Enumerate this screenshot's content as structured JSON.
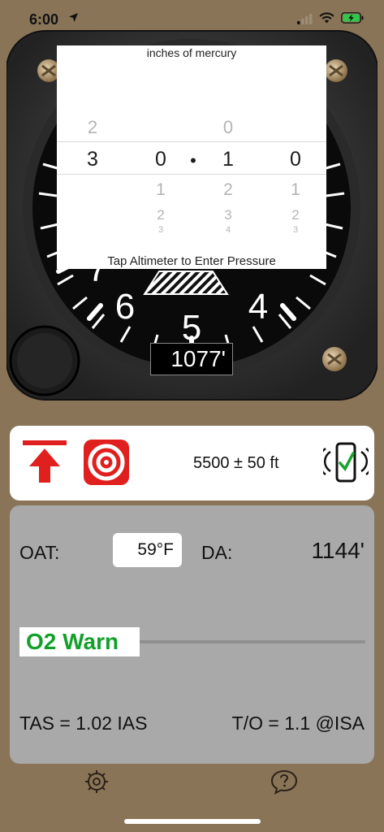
{
  "status_bar": {
    "time": "6:00"
  },
  "picker": {
    "title": "inches of mercury",
    "columns": [
      {
        "above": "",
        "selected": "3",
        "below": []
      },
      {
        "above": "",
        "selected": "0",
        "below": [
          "1",
          "2",
          "3"
        ]
      },
      {
        "above": "",
        "selected": "•",
        "below": []
      },
      {
        "above": "0",
        "selected": "1",
        "below": [
          "2",
          "3",
          "4"
        ]
      },
      {
        "above": "",
        "selected": "0",
        "below": [
          "1",
          "2",
          "3"
        ]
      }
    ],
    "above_first": "2",
    "footer": "Tap Altimeter to Enter Pressure"
  },
  "altimeter": {
    "readout": "1077'",
    "dial_numbers": [
      "4",
      "5",
      "6",
      "7"
    ]
  },
  "pressure_card": {
    "altitude_text": "5500 ± 50 ft",
    "icons": [
      "altitude-mark-icon",
      "target-icon",
      "phone-connected-icon"
    ]
  },
  "info_card": {
    "oat_label": "OAT:",
    "oat_value": "59°F",
    "da_label": "DA:",
    "da_value": "1144'",
    "o2_warn": "O2 Warn",
    "tas": "TAS = 1.02 IAS",
    "to": "T/O =  1.1 @ISA"
  },
  "toolbar": {
    "icons": [
      "gear-icon",
      "help-icon"
    ]
  },
  "colors": {
    "background": "#8a7457",
    "warn_green": "#12a02a",
    "accent_red": "#e0201e"
  }
}
